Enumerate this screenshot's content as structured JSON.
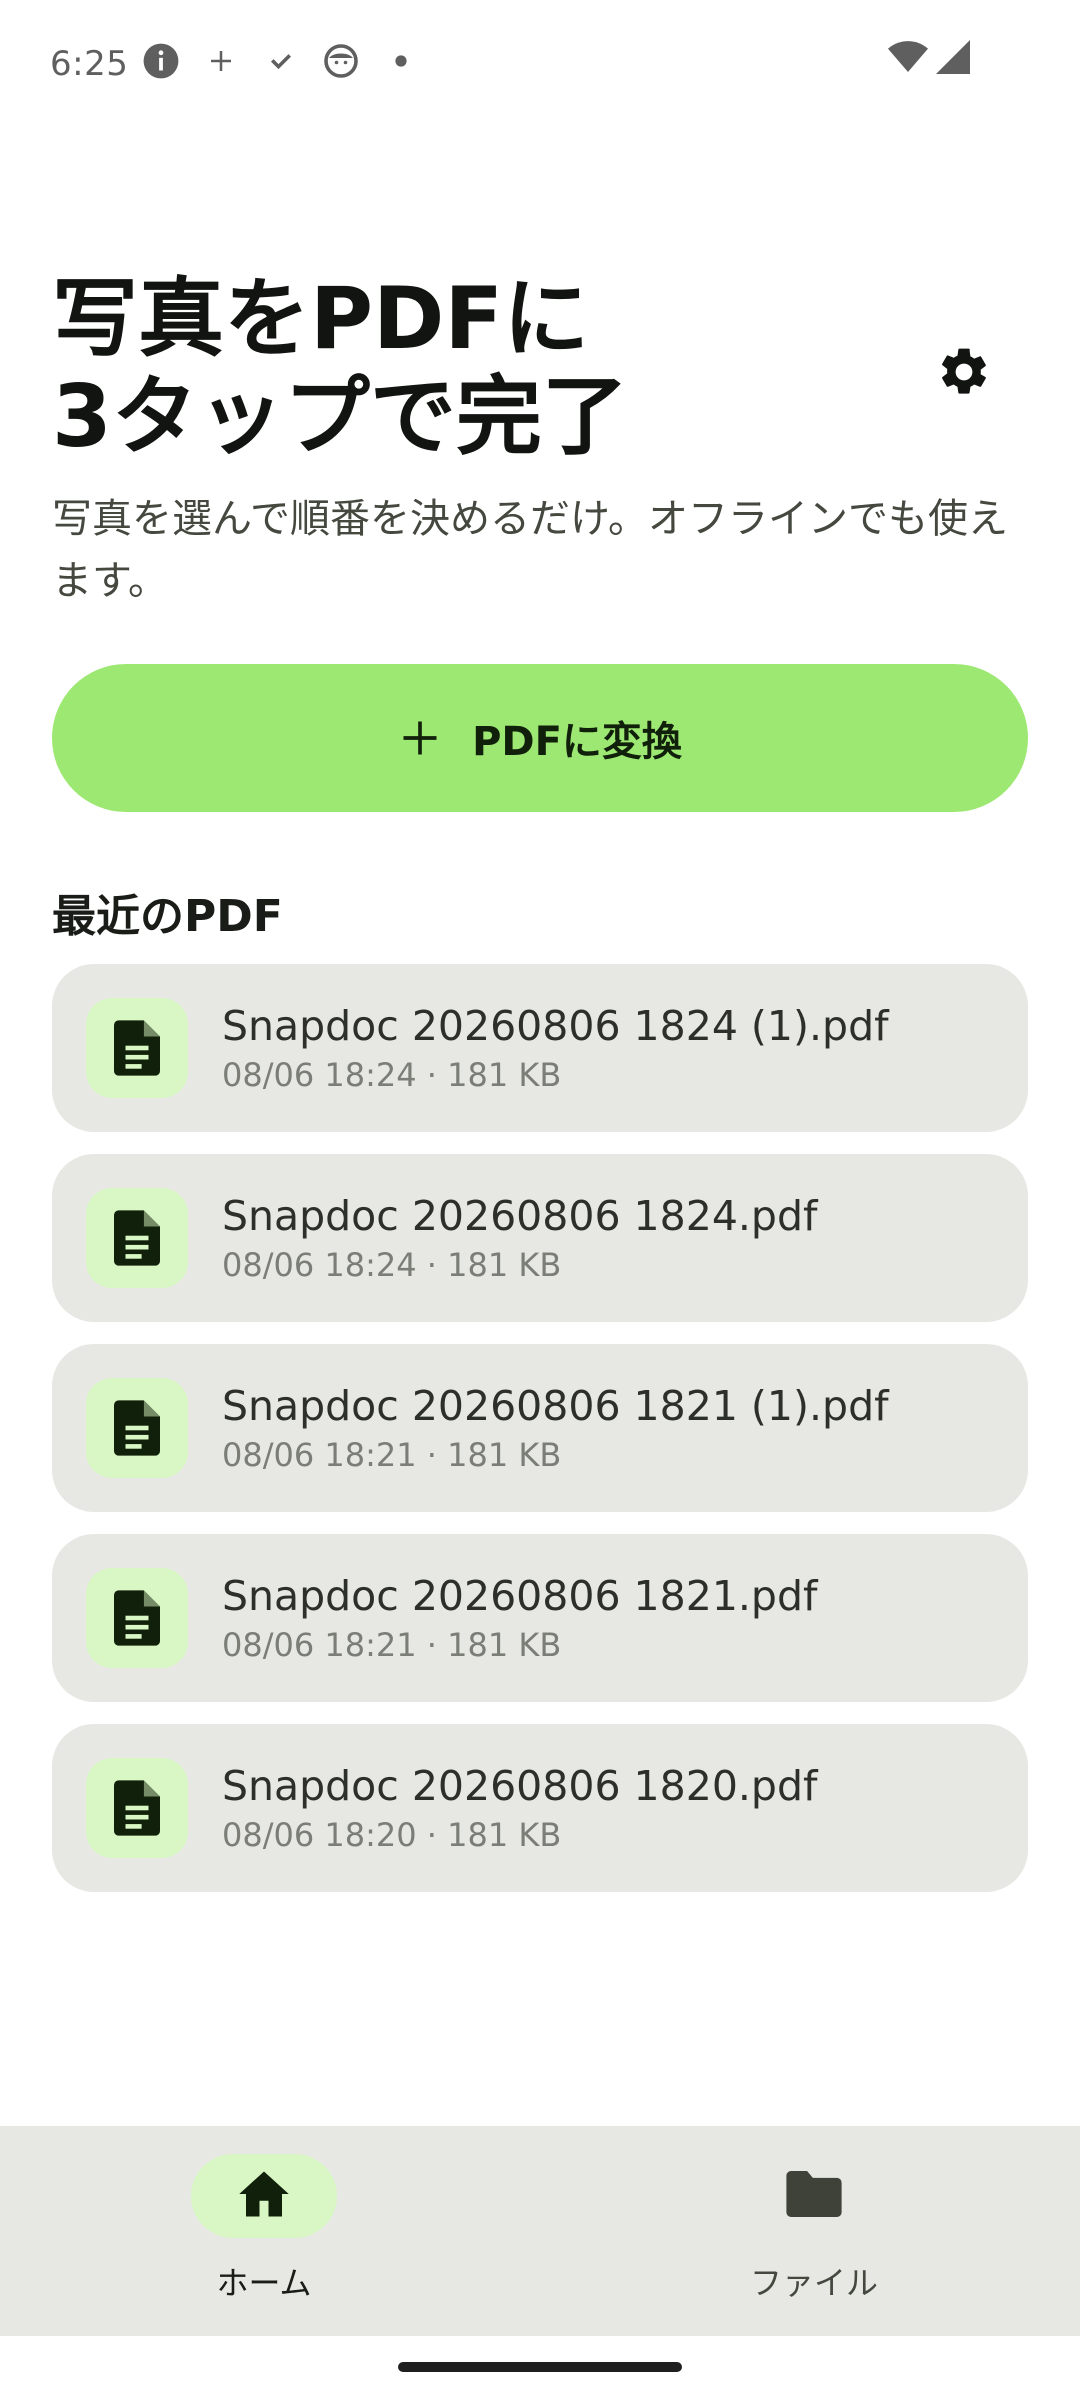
{
  "status_bar": {
    "time": "6:25"
  },
  "header": {
    "title": "写真をPDFに\n3タップで完了",
    "subtitle": "写真を選んで順番を決めるだけ。オフラインでも使えます。"
  },
  "actions": {
    "convert_label": "PDFに変換"
  },
  "recent": {
    "title": "最近のPDF",
    "files": [
      {
        "name": "Snapdoc 20260806 1824 (1).pdf",
        "meta": "08/06 18:24 · 181 KB"
      },
      {
        "name": "Snapdoc 20260806 1824.pdf",
        "meta": "08/06 18:24 · 181 KB"
      },
      {
        "name": "Snapdoc 20260806 1821 (1).pdf",
        "meta": "08/06 18:21 · 181 KB"
      },
      {
        "name": "Snapdoc 20260806 1821.pdf",
        "meta": "08/06 18:21 · 181 KB"
      },
      {
        "name": "Snapdoc 20260806 1820.pdf",
        "meta": "08/06 18:20 · 181 KB"
      }
    ]
  },
  "bottom_nav": {
    "items": [
      {
        "label": "ホーム",
        "icon": "home-icon",
        "selected": true
      },
      {
        "label": "ファイル",
        "icon": "folder-icon",
        "selected": false
      }
    ]
  },
  "colors": {
    "accent": "#9de872",
    "accent_container": "#d9f7c4",
    "card_background": "#e7e8e3",
    "icon_dark": "#11200a"
  }
}
